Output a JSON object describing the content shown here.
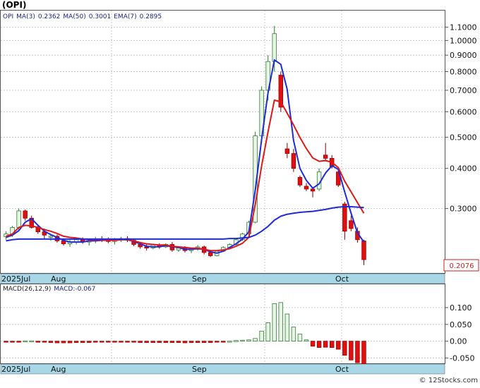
{
  "header": {
    "ticker_title": "(OPI)",
    "legend": [
      {
        "text": "OPI",
        "color": "#1a237e"
      },
      {
        "text": "MA(3)",
        "color": "#1a237e"
      },
      {
        "text": "0.2362",
        "color": "#1a237e"
      },
      {
        "text": "MA(50)",
        "color": "#1a237e"
      },
      {
        "text": "0.3001",
        "color": "#1a237e"
      },
      {
        "text": "EMA(7)",
        "color": "#1a237e"
      },
      {
        "text": "0.2895",
        "color": "#1a237e"
      }
    ]
  },
  "price_panel": {
    "last_price_label": "0.2076",
    "y_ticks": [
      "1.1000",
      "1.0000",
      "0.9000",
      "0.8000",
      "0.7000",
      "0.6000",
      "0.5000",
      "0.4000",
      "0.3000"
    ],
    "x_labels": [
      "2025Jul",
      "Aug",
      "Sep",
      "Oct"
    ]
  },
  "macd_panel": {
    "legend": [
      {
        "text": "MACD(26,12,9)",
        "color": "#222222"
      },
      {
        "text": "MACD:-0.067",
        "color": "#1a237e"
      }
    ],
    "y_ticks": [
      "0.100",
      "0.050",
      "0.00",
      "-0.050"
    ],
    "x_labels": [
      "2025Jul",
      "Aug",
      "Sep",
      "Oct"
    ]
  },
  "footer": {
    "copyright": "© 12Stocks.com"
  },
  "colors": {
    "up_candle": "#e8f5e4",
    "up_candle_border": "#2e7d32",
    "down_candle": "#e01010",
    "ma_fast": "#1e2bd6",
    "ema": "#e01818",
    "axis_band": "#a8d8e8",
    "grid": "#c8c8c8",
    "macd_pos": "#e8f5e4",
    "macd_neg": "#e01010"
  },
  "chart_data": [
    {
      "type": "candlestick",
      "title": "(OPI)",
      "y_scale": "log",
      "ylim": [
        0.19,
        1.16
      ],
      "x_labels": [
        "2025Jul",
        "Aug",
        "Sep",
        "Oct"
      ],
      "ohlc": [
        [
          0.245,
          0.255,
          0.24,
          0.25
        ],
        [
          0.25,
          0.265,
          0.245,
          0.262
        ],
        [
          0.262,
          0.3,
          0.258,
          0.295
        ],
        [
          0.295,
          0.298,
          0.275,
          0.28
        ],
        [
          0.28,
          0.285,
          0.26,
          0.262
        ],
        [
          0.262,
          0.266,
          0.25,
          0.254
        ],
        [
          0.254,
          0.26,
          0.242,
          0.248
        ],
        [
          0.245,
          0.25,
          0.238,
          0.246
        ],
        [
          0.246,
          0.249,
          0.235,
          0.238
        ],
        [
          0.238,
          0.242,
          0.23,
          0.233
        ],
        [
          0.233,
          0.24,
          0.228,
          0.236
        ],
        [
          0.236,
          0.242,
          0.232,
          0.24
        ],
        [
          0.24,
          0.244,
          0.233,
          0.236
        ],
        [
          0.236,
          0.24,
          0.23,
          0.238
        ],
        [
          0.238,
          0.245,
          0.234,
          0.241
        ],
        [
          0.241,
          0.246,
          0.236,
          0.239
        ],
        [
          0.239,
          0.244,
          0.234,
          0.237
        ],
        [
          0.237,
          0.243,
          0.232,
          0.24
        ],
        [
          0.24,
          0.245,
          0.236,
          0.242
        ],
        [
          0.242,
          0.246,
          0.236,
          0.239
        ],
        [
          0.239,
          0.241,
          0.229,
          0.232
        ],
        [
          0.232,
          0.235,
          0.225,
          0.228
        ],
        [
          0.228,
          0.232,
          0.222,
          0.226
        ],
        [
          0.226,
          0.233,
          0.224,
          0.231
        ],
        [
          0.231,
          0.234,
          0.225,
          0.228
        ],
        [
          0.228,
          0.234,
          0.226,
          0.232
        ],
        [
          0.232,
          0.236,
          0.22,
          0.223
        ],
        [
          0.223,
          0.228,
          0.22,
          0.226
        ],
        [
          0.226,
          0.229,
          0.219,
          0.222
        ],
        [
          0.222,
          0.226,
          0.218,
          0.224
        ],
        [
          0.224,
          0.231,
          0.222,
          0.228
        ],
        [
          0.228,
          0.23,
          0.216,
          0.219
        ],
        [
          0.219,
          0.223,
          0.212,
          0.214
        ],
        [
          0.214,
          0.222,
          0.213,
          0.221
        ],
        [
          0.221,
          0.229,
          0.22,
          0.227
        ],
        [
          0.227,
          0.234,
          0.225,
          0.232
        ],
        [
          0.232,
          0.242,
          0.23,
          0.24
        ],
        [
          0.24,
          0.252,
          0.238,
          0.25
        ],
        [
          0.25,
          0.275,
          0.248,
          0.272
        ],
        [
          0.272,
          0.52,
          0.27,
          0.505
        ],
        [
          0.505,
          0.72,
          0.48,
          0.7
        ],
        [
          0.7,
          0.9,
          0.65,
          0.86
        ],
        [
          0.86,
          1.11,
          0.8,
          1.05
        ],
        [
          0.78,
          0.8,
          0.6,
          0.62
        ],
        [
          0.46,
          0.48,
          0.43,
          0.445
        ],
        [
          0.445,
          0.46,
          0.39,
          0.4
        ],
        [
          0.375,
          0.38,
          0.35,
          0.355
        ],
        [
          0.352,
          0.36,
          0.34,
          0.345
        ],
        [
          0.345,
          0.35,
          0.325,
          0.34
        ],
        [
          0.345,
          0.4,
          0.34,
          0.39
        ],
        [
          0.44,
          0.48,
          0.42,
          0.43
        ],
        [
          0.43,
          0.44,
          0.4,
          0.405
        ],
        [
          0.39,
          0.395,
          0.35,
          0.355
        ],
        [
          0.31,
          0.315,
          0.24,
          0.255
        ],
        [
          0.275,
          0.285,
          0.255,
          0.26
        ],
        [
          0.255,
          0.262,
          0.235,
          0.24
        ],
        [
          0.238,
          0.24,
          0.2,
          0.208
        ]
      ],
      "series": [
        {
          "name": "MA(3)",
          "values": [
            0.244,
            0.248,
            0.256,
            0.272,
            0.279,
            0.266,
            0.255,
            0.249,
            0.244,
            0.239,
            0.236,
            0.236,
            0.236,
            0.238,
            0.238,
            0.239,
            0.239,
            0.239,
            0.24,
            0.24,
            0.237,
            0.233,
            0.229,
            0.228,
            0.228,
            0.23,
            0.228,
            0.227,
            0.224,
            0.224,
            0.225,
            0.224,
            0.22,
            0.218,
            0.221,
            0.227,
            0.233,
            0.241,
            0.254,
            0.342,
            0.492,
            0.688,
            0.87,
            0.843,
            0.705,
            0.488,
            0.4,
            0.367,
            0.347,
            0.358,
            0.387,
            0.408,
            0.397,
            0.338,
            0.29,
            0.252,
            0.236
          ]
        },
        {
          "name": "EMA(7)",
          "values": [
            0.246,
            0.25,
            0.262,
            0.266,
            0.265,
            0.262,
            0.258,
            0.255,
            0.251,
            0.246,
            0.244,
            0.243,
            0.241,
            0.24,
            0.24,
            0.24,
            0.239,
            0.239,
            0.24,
            0.24,
            0.238,
            0.235,
            0.233,
            0.232,
            0.231,
            0.231,
            0.229,
            0.228,
            0.227,
            0.226,
            0.226,
            0.224,
            0.222,
            0.222,
            0.223,
            0.225,
            0.229,
            0.234,
            0.244,
            0.309,
            0.407,
            0.52,
            0.652,
            0.644,
            0.594,
            0.546,
            0.499,
            0.461,
            0.431,
            0.421,
            0.423,
            0.418,
            0.402,
            0.365,
            0.338,
            0.313,
            0.29
          ]
        },
        {
          "name": "MA(50)",
          "values": [
            0.238,
            0.24,
            0.241,
            0.241,
            0.241,
            0.241,
            0.241,
            0.241,
            0.241,
            0.241,
            0.241,
            0.241,
            0.241,
            0.241,
            0.241,
            0.241,
            0.241,
            0.241,
            0.241,
            0.241,
            0.241,
            0.241,
            0.241,
            0.241,
            0.241,
            0.241,
            0.241,
            0.241,
            0.241,
            0.241,
            0.241,
            0.241,
            0.241,
            0.241,
            0.241,
            0.242,
            0.242,
            0.243,
            0.244,
            0.248,
            0.255,
            0.264,
            0.276,
            0.284,
            0.288,
            0.29,
            0.292,
            0.293,
            0.294,
            0.296,
            0.298,
            0.301,
            0.303,
            0.304,
            0.304,
            0.303,
            0.302
          ]
        }
      ]
    },
    {
      "type": "bar",
      "title": "MACD(26,12,9)",
      "ylim": [
        -0.068,
        0.142
      ],
      "x_labels": [
        "2025Jul",
        "Aug",
        "Sep",
        "Oct"
      ],
      "values": [
        -0.003,
        -0.003,
        -0.002,
        0.001,
        0.001,
        -0.002,
        -0.003,
        -0.004,
        -0.005,
        -0.005,
        -0.005,
        -0.004,
        -0.004,
        -0.004,
        -0.003,
        -0.003,
        -0.003,
        -0.003,
        -0.002,
        -0.002,
        -0.003,
        -0.004,
        -0.004,
        -0.004,
        -0.004,
        -0.004,
        -0.004,
        -0.004,
        -0.005,
        -0.004,
        -0.004,
        -0.004,
        -0.004,
        -0.003,
        -0.002,
        0.0,
        0.002,
        0.003,
        0.004,
        0.008,
        0.03,
        0.055,
        0.112,
        0.115,
        0.081,
        0.042,
        0.021,
        0.004,
        -0.015,
        -0.019,
        -0.018,
        -0.019,
        -0.024,
        -0.042,
        -0.056,
        -0.064,
        -0.067
      ]
    }
  ]
}
